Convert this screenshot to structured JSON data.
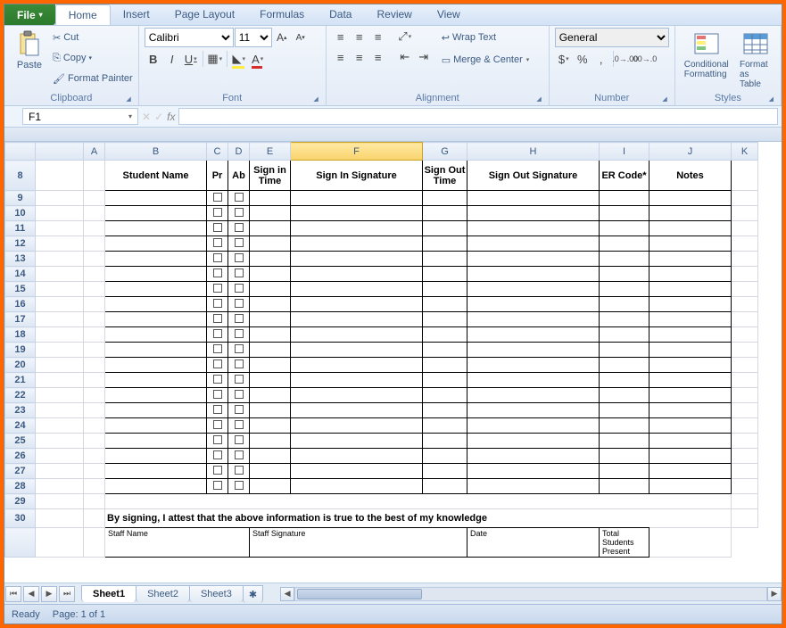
{
  "menu": {
    "file": "File",
    "tabs": [
      "Home",
      "Insert",
      "Page Layout",
      "Formulas",
      "Data",
      "Review",
      "View"
    ],
    "active": "Home"
  },
  "ribbon": {
    "clipboard": {
      "label": "Clipboard",
      "paste": "Paste",
      "cut": "Cut",
      "copy": "Copy",
      "fpainter": "Format Painter"
    },
    "font": {
      "label": "Font",
      "name": "Calibri",
      "size": "11"
    },
    "alignment": {
      "label": "Alignment",
      "wrap": "Wrap Text",
      "merge": "Merge & Center"
    },
    "number": {
      "label": "Number",
      "format": "General"
    },
    "styles": {
      "label": "Styles",
      "cond": "Conditional Formatting",
      "table": "Format as Table"
    }
  },
  "formula": {
    "namebox": "F1",
    "fx": "fx"
  },
  "columns": [
    "A",
    "B",
    "C",
    "D",
    "E",
    "F",
    "G",
    "H",
    "I",
    "J",
    "K"
  ],
  "selectedCol": "F",
  "rows": [
    8,
    9,
    10,
    11,
    12,
    13,
    14,
    15,
    16,
    17,
    18,
    19,
    20,
    21,
    22,
    23,
    24,
    25,
    26,
    27,
    28,
    29,
    30
  ],
  "headers": {
    "student": "Student Name",
    "pr": "Pr",
    "ab": "Ab",
    "sin": "Sign in Time",
    "sinsig": "Sign In Signature",
    "sout": "Sign Out Time",
    "soutsig": "Sign Out Signature",
    "er": "ER Code*",
    "notes": "Notes"
  },
  "attest": "By signing, I attest that the above information is true to the best of my knowledge",
  "sig": {
    "staffname": "Staff Name",
    "staffsig": "Staff Signature",
    "date": "Date",
    "total": "Total Students Present"
  },
  "sheets": [
    "Sheet1",
    "Sheet2",
    "Sheet3"
  ],
  "activeSheet": "Sheet1",
  "status": {
    "ready": "Ready",
    "page": "Page: 1 of 1"
  }
}
